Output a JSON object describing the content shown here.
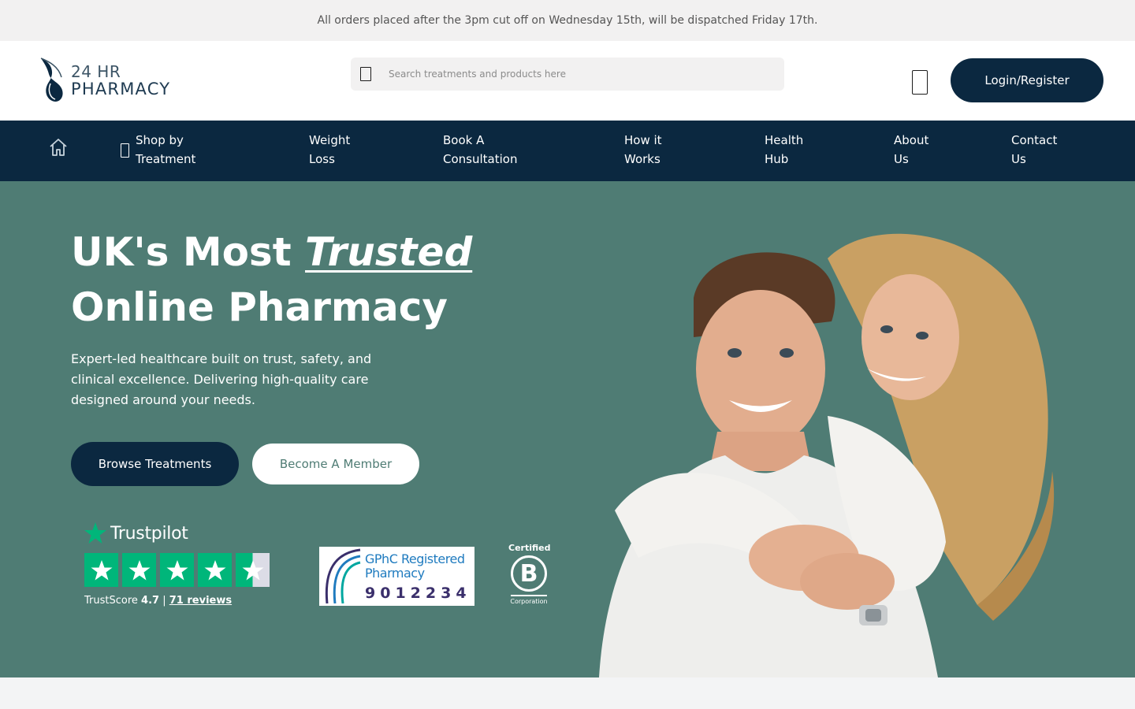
{
  "announcement": "All orders placed after the 3pm cut off on Wednesday 15th, will be dispatched Friday 17th.",
  "header": {
    "logo_line1": "24 HR",
    "logo_line2": "PHARMACY",
    "search_placeholder": "Search treatments and products here",
    "login_label": "Login/Register"
  },
  "nav": {
    "items": [
      {
        "line1": "Shop by",
        "line2": "Treatment"
      },
      {
        "line1": "Weight",
        "line2": "Loss"
      },
      {
        "line1": "Book A",
        "line2": "Consultation"
      },
      {
        "line1": "How it",
        "line2": "Works"
      },
      {
        "line1": "Health",
        "line2": "Hub"
      },
      {
        "line1": "About",
        "line2": "Us"
      },
      {
        "line1": "Contact",
        "line2": "Us"
      }
    ]
  },
  "hero": {
    "title_prefix": "UK's Most ",
    "title_accent": "Trusted",
    "title_line2": "Online Pharmacy",
    "subtitle": "Expert-led healthcare built on trust, safety, and clinical excellence. Delivering high-quality care designed around your needs.",
    "primary_cta": "Browse Treatments",
    "secondary_cta": "Become A Member"
  },
  "trustpilot": {
    "brand": "Trustpilot",
    "score_label": "TrustScore",
    "score": "4.7",
    "separator": "|",
    "reviews": "71 reviews",
    "stars": 4.5
  },
  "gphc": {
    "line1": "GPhC Registered",
    "line2": "Pharmacy",
    "number": "9012234"
  },
  "bcorp": {
    "top": "Certified",
    "letter": "B",
    "bottom": "Corporation"
  },
  "colors": {
    "navy": "#0b2840",
    "hero_green": "#4f7c74",
    "trustpilot_green": "#00b67a"
  }
}
